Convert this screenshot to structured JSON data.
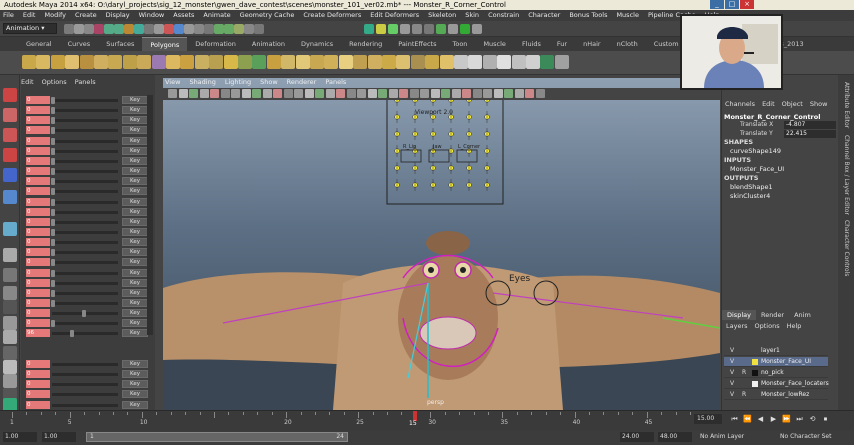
{
  "title_bar": {
    "text": "Autodesk Maya 2014 x64: O:\\daryl_projects\\sig_12_monster\\gwen_dave_contest\\scenes\\monster_101_ver02.mb*  ---  Monster_R_Corner_Control"
  },
  "menu": [
    "File",
    "Edit",
    "Modify",
    "Create",
    "Display",
    "Window",
    "Assets",
    "Animate",
    "Geometry Cache",
    "Create Deformers",
    "Edit Deformers",
    "Skeleton",
    "Skin",
    "Constrain",
    "Character",
    "Bonus Tools",
    "Muscle",
    "Pipeline Cache",
    "Help"
  ],
  "status_line": {
    "mode": "Animation"
  },
  "shelf_tabs": [
    "General",
    "Curves",
    "Surfaces",
    "Polygons",
    "Deformation",
    "Animation",
    "Dynamics",
    "Rendering",
    "PaintEffects",
    "Toon",
    "Muscle",
    "Fluids",
    "Fur",
    "nHair",
    "nCloth",
    "Custom",
    "XGen",
    "TURTLE",
    "RWB_2013"
  ],
  "active_shelf": "Polygons",
  "left_panel": {
    "menu": [
      "Edit",
      "Options",
      "Panels"
    ],
    "rows": [
      {
        "label": "0",
        "key": "Key",
        "knob": 0.0
      },
      {
        "label": "0",
        "key": "Key",
        "knob": 0.0
      },
      {
        "label": "0",
        "key": "Key",
        "knob": 0.0
      },
      {
        "label": "0",
        "key": "Key",
        "knob": 0.0
      },
      {
        "label": "0",
        "key": "Key",
        "knob": 0.0
      },
      {
        "label": "0",
        "key": "Key",
        "knob": 0.0
      },
      {
        "label": "0",
        "key": "Key",
        "knob": 0.0
      },
      {
        "label": "0",
        "key": "Key",
        "knob": 0.0
      },
      {
        "label": "0",
        "key": "Key",
        "knob": 0.0
      },
      {
        "label": "0",
        "key": "Key",
        "knob": 0.0
      },
      {
        "label": "0",
        "key": "Key",
        "knob": 0.0
      },
      {
        "label": "0",
        "key": "Key",
        "knob": 0.0
      },
      {
        "label": "0",
        "key": "Key",
        "knob": 0.0
      },
      {
        "label": "0",
        "key": "Key",
        "knob": 0.0
      },
      {
        "label": "0",
        "key": "Key",
        "knob": 0.0
      },
      {
        "label": "0",
        "key": "Key",
        "knob": 0.0
      },
      {
        "label": "0",
        "key": "Key",
        "knob": 0.0
      },
      {
        "label": "0",
        "key": "Key",
        "knob": 0.0
      },
      {
        "label": "0",
        "key": "Key",
        "knob": 0.0
      },
      {
        "label": "0",
        "key": "Key",
        "knob": 0.0
      },
      {
        "label": "0",
        "key": "Key",
        "knob": 0.0
      },
      {
        "label": "0",
        "key": "Key",
        "knob": 0.5
      },
      {
        "label": "0",
        "key": "Key",
        "knob": 0.0
      },
      {
        "label": "96",
        "key": "Key",
        "knob": 0.3
      }
    ],
    "lower_rows": [
      {
        "label": "0",
        "key": "Key"
      },
      {
        "label": "0",
        "key": "Key"
      },
      {
        "label": "0",
        "key": "Key"
      },
      {
        "label": "0",
        "key": "Key"
      },
      {
        "label": "0",
        "key": "Key"
      },
      {
        "label": "0",
        "key": "Key"
      }
    ]
  },
  "viewport": {
    "menu": [
      "View",
      "Shading",
      "Lighting",
      "Show",
      "Renderer",
      "Panels"
    ],
    "ui_panel_title": "Viewport 2.0",
    "ui_labels": [
      "R_Lip",
      "Jaw",
      "L_Corner"
    ],
    "eyes_label": "Eyes",
    "bottom_label": "persp"
  },
  "channel_box": {
    "menu": [
      "Channels",
      "Edit",
      "Object",
      "Show"
    ],
    "object_name": "Monster_R_Corner_Control",
    "attributes": [
      {
        "name": "Translate X",
        "value": "-4.807"
      },
      {
        "name": "Translate Y",
        "value": "22.415"
      }
    ],
    "shapes_header": "SHAPES",
    "shapes": [
      "curveShape149"
    ],
    "inputs_header": "INPUTS",
    "inputs": [
      "Monster_Face_UI"
    ],
    "outputs_header": "OUTPUTS",
    "outputs": [
      "blendShape1",
      "skinCluster4"
    ]
  },
  "layer_editor": {
    "tabs": [
      "Display",
      "Render",
      "Anim"
    ],
    "menu": [
      "Layers",
      "Options",
      "Help"
    ],
    "layers": [
      {
        "v": "V",
        "r": "",
        "name": "layer1",
        "color": "#444444"
      },
      {
        "v": "V",
        "r": "",
        "name": "Monster_Face_UI",
        "color": "#f0e040"
      },
      {
        "v": "V",
        "r": "R",
        "name": "no_pick",
        "color": "#111111"
      },
      {
        "v": "V",
        "r": "",
        "name": "Monster_Face_locaters",
        "color": "#f0f0f0"
      },
      {
        "v": "V",
        "r": "R",
        "name": "Monster_lowRez",
        "color": "#444444"
      }
    ]
  },
  "side_tabs": [
    "Attribute Editor",
    "Channel Box / Layer Editor",
    "Character Controls"
  ],
  "time_slider": {
    "ticks": [
      "1",
      "5",
      "10",
      "15",
      "20",
      "25",
      "30",
      "35",
      "40",
      "45"
    ],
    "current_frame_label": "15",
    "current_frame": "15.00"
  },
  "range_bar": {
    "start": "1.00",
    "start2": "1.00",
    "slider_start": "1",
    "slider_end": "24",
    "end": "24.00",
    "end2": "48.00",
    "anim_layer": "No Anim Layer",
    "character_set": "No Character Set"
  }
}
